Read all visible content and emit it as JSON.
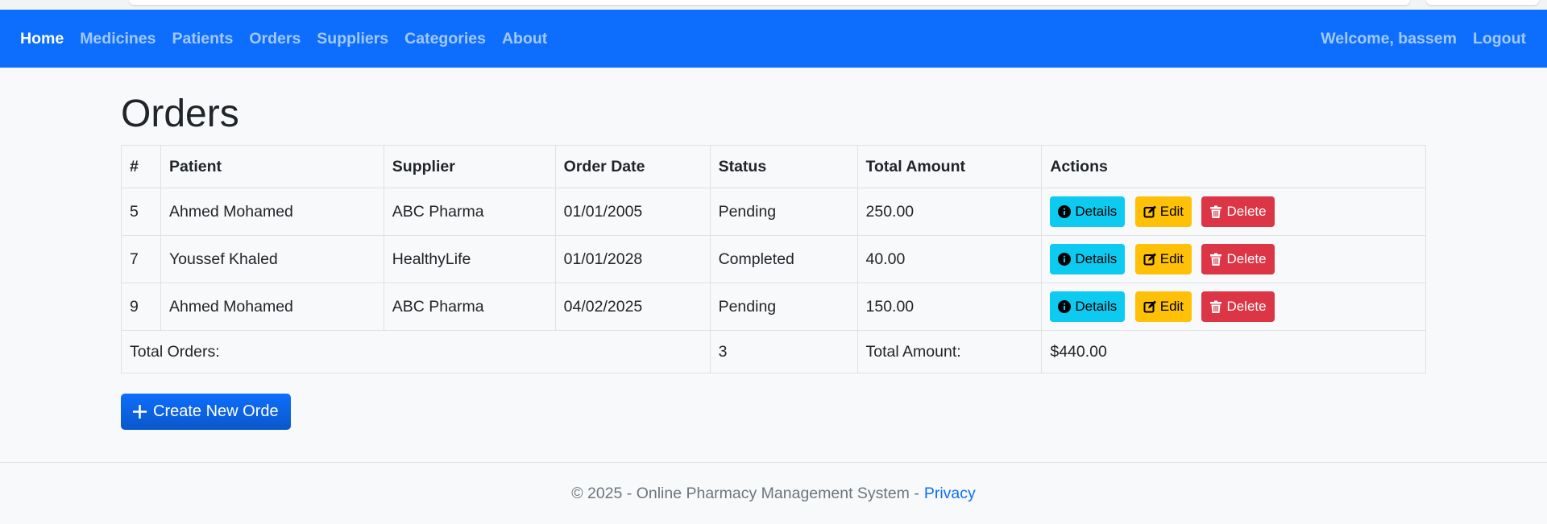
{
  "navbar": {
    "brand_color": "#0d6efd",
    "links": [
      {
        "label": "Home",
        "active": true
      },
      {
        "label": "Medicines"
      },
      {
        "label": "Patients"
      },
      {
        "label": "Orders"
      },
      {
        "label": "Suppliers"
      },
      {
        "label": "Categories"
      },
      {
        "label": "About"
      }
    ],
    "welcome": "Welcome, bassem",
    "logout": "Logout"
  },
  "page": {
    "title": "Orders"
  },
  "table": {
    "headers": [
      "#",
      "Patient",
      "Supplier",
      "Order Date",
      "Status",
      "Total Amount",
      "Actions"
    ],
    "rows": [
      {
        "id": "5",
        "patient": "Ahmed Mohamed",
        "supplier": "ABC Pharma",
        "date": "01/01/2005",
        "status": "Pending",
        "amount": "250.00"
      },
      {
        "id": "7",
        "patient": "Youssef Khaled",
        "supplier": "HealthyLife",
        "date": "01/01/2028",
        "status": "Completed",
        "amount": "40.00"
      },
      {
        "id": "9",
        "patient": "Ahmed Mohamed",
        "supplier": "ABC Pharma",
        "date": "04/02/2025",
        "status": "Pending",
        "amount": "150.00"
      }
    ],
    "actions": {
      "details": "Details",
      "edit": "Edit",
      "delete": "Delete",
      "details_icon": "info-circle-icon",
      "edit_icon": "pencil-square-icon",
      "delete_icon": "trash-icon"
    },
    "footer": {
      "total_orders_label": "Total Orders:",
      "total_orders_value": "3",
      "total_amount_label": "Total Amount:",
      "total_amount_value": "$440.00"
    }
  },
  "create_button": {
    "label": "Create New Orde",
    "icon": "plus-icon"
  },
  "footer": {
    "text": "© 2025 - Online Pharmacy Management System -",
    "privacy": "Privacy"
  }
}
